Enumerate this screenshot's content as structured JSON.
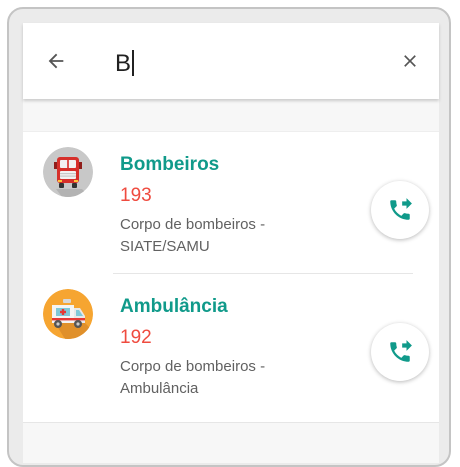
{
  "search": {
    "query": "B",
    "back_icon": "arrow-back-icon",
    "clear_icon": "close-icon"
  },
  "results": [
    {
      "name": "Bombeiros",
      "phone": "193",
      "description": "Corpo de bombeiros - SIATE/SAMU",
      "icon": "fire-truck-icon",
      "action_icon": "phone-forward-icon"
    },
    {
      "name": "Ambulância",
      "phone": "192",
      "description": "Corpo de bombeiros - Ambulância",
      "icon": "ambulance-icon",
      "action_icon": "phone-forward-icon"
    }
  ],
  "colors": {
    "accent": "#109a8a",
    "phone": "#ef4b3f",
    "ambulance_bg": "#f6a531"
  }
}
